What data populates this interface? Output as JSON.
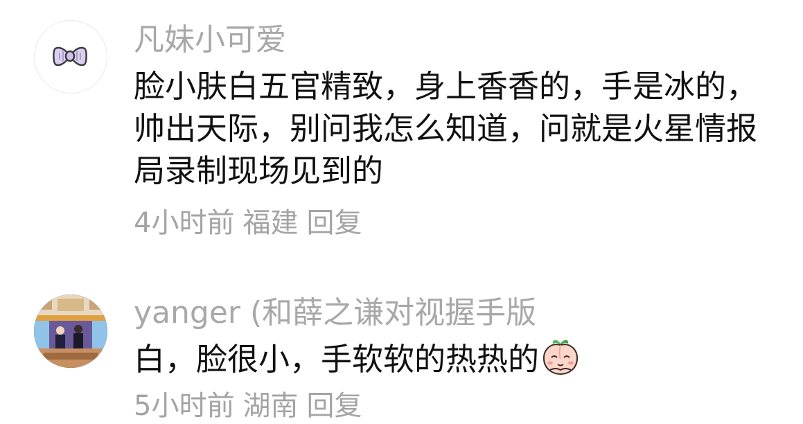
{
  "comments": [
    {
      "username": "凡妹小可爱",
      "avatar_icon": "bow-icon",
      "text": "脸小肤白五官精致，身上香香的，手是冰的，帅出天际，别问我怎么知道，问就是火星情报局录制现场见到的",
      "time": "4小时前",
      "location": "福建",
      "reply_label": "回复"
    },
    {
      "username": "yanger (和薛之谦对视握手版",
      "avatar_icon": "stage-photo-avatar",
      "text": "白，脸很小，手软软的热热的",
      "emoji_icon": "peach-face-emoji-icon",
      "time": "5小时前",
      "location": "湖南",
      "reply_label": "回复"
    }
  ],
  "colors": {
    "username": "#a8a8a8",
    "text": "#111111",
    "meta": "#a4a4a4"
  }
}
